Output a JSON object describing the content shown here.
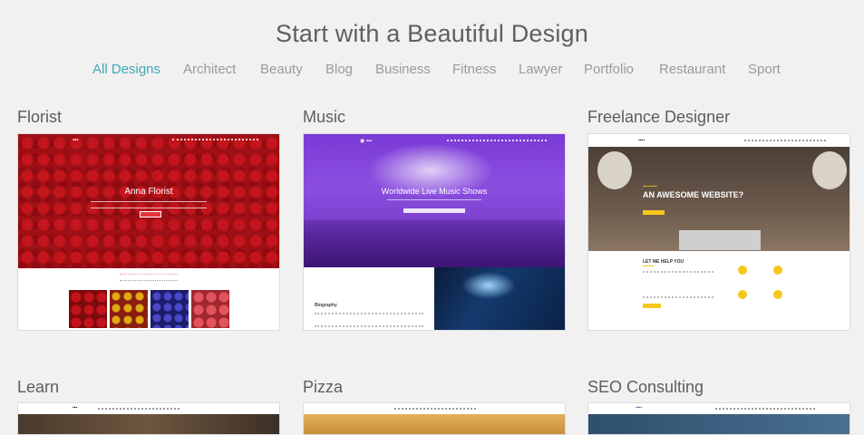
{
  "page": {
    "title": "Start with a Beautiful Design"
  },
  "filters": [
    "All Designs",
    "Architect",
    "Beauty",
    "Blog",
    "Business",
    "Fitness",
    "Lawyer",
    "Portfolio",
    "Restaurant",
    "Sport"
  ],
  "active_filter": "All Designs",
  "cards": {
    "florist": {
      "title": "Florist",
      "hero_name": "Anna Florist"
    },
    "music": {
      "title": "Music",
      "hero_heading": "Worldwide Live Music Shows",
      "section_label": "Biography"
    },
    "freelance": {
      "title": "Freelance Designer",
      "hero_heading": "AN AWESOME WEBSITE?",
      "section_label": "LET ME HELP YOU"
    },
    "learn": {
      "title": "Learn"
    },
    "pizza": {
      "title": "Pizza"
    },
    "seo": {
      "title": "SEO Consulting"
    }
  },
  "colors": {
    "accent": "#3fa9b5",
    "background": "#f1f1f1",
    "freelance_yellow": "#f7c61a"
  }
}
